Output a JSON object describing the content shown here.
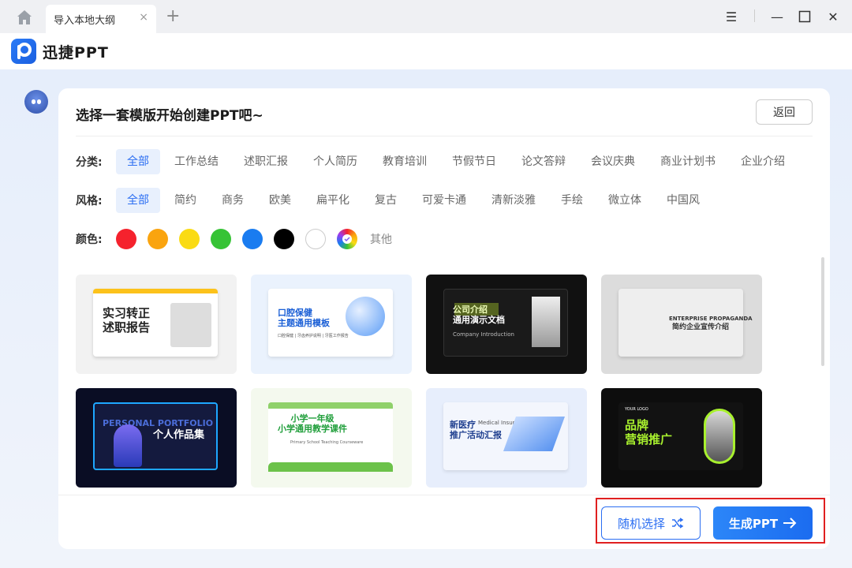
{
  "tab": {
    "label": "导入本地大纲",
    "close": "×",
    "add": "+"
  },
  "window": {
    "menu": "☰",
    "minimize": "—",
    "maximize": "☐",
    "close": "✕"
  },
  "app": {
    "name": "迅捷PPT"
  },
  "card": {
    "title": "选择一套模版开始创建PPT吧~",
    "back_label": "返回"
  },
  "category": {
    "label": "分类:",
    "items": [
      "全部",
      "工作总结",
      "述职汇报",
      "个人简历",
      "教育培训",
      "节假节日",
      "论文答辩",
      "会议庆典",
      "商业计划书",
      "企业介绍"
    ],
    "active_index": 0
  },
  "style": {
    "label": "风格:",
    "items": [
      "全部",
      "简约",
      "商务",
      "欧美",
      "扁平化",
      "复古",
      "可爱卡通",
      "清新淡雅",
      "手绘",
      "微立体",
      "中国风"
    ],
    "active_index": 0
  },
  "color": {
    "label": "颜色:",
    "swatches": [
      "#f5222d",
      "#faa40f",
      "#fadb14",
      "#36c335",
      "#1a7cf0",
      "#000000",
      "#ffffff",
      "rainbow"
    ],
    "other_label": "其他"
  },
  "templates": [
    {
      "title": "实习转正\n述职报告",
      "bg": "#f2f2f2",
      "accent": "#fcc21b",
      "text": "#222222",
      "sub": ""
    },
    {
      "title": "口腔保健\n主题通用模板",
      "bg": "#eaf2fd",
      "accent": "#ffffff",
      "text": "#1a5fd6",
      "sub": "口腔保健 | 牙齿养护说明 | 牙医工作报告"
    },
    {
      "title": "公司介绍\n通用演示文档",
      "bg": "#111111",
      "accent": "#1a1a1a",
      "text": "#ffffff",
      "sub": "Company Introduction"
    },
    {
      "title": "简约企业宣传介绍",
      "bg": "#dcdcdc",
      "accent": "#eeeeee",
      "text": "#333333",
      "sub": "ENTERPRISE PROPAGANDA"
    },
    {
      "title": "个人作品集",
      "bg": "#0a0d24",
      "accent": "#141a3e",
      "text": "#ffffff",
      "sub": "PERSONAL PORTFOLIO"
    },
    {
      "title": "小学一年级\n小学通用教学课件",
      "bg": "#f4f9ee",
      "accent": "#ffffff",
      "text": "#1f9e3a",
      "sub": "Primary School Teaching Courseware"
    },
    {
      "title": "新医疗\n推广活动汇报",
      "bg": "#e7eefc",
      "accent": "#f3f6fd",
      "text": "#1f3f8f",
      "sub": "Medical Insurance"
    },
    {
      "title": "品牌\n营销推广",
      "bg": "#0d0d0d",
      "accent": "#121212",
      "text": "#ffffff",
      "sub": "YOUR LOGO"
    }
  ],
  "footer": {
    "random_label": "随机选择",
    "random_icon": "shuffle-icon",
    "generate_label": "生成PPT",
    "generate_icon": "arrow-right-icon"
  },
  "colors": {
    "primary": "#2b6ef2",
    "highlight": "#e02020"
  }
}
